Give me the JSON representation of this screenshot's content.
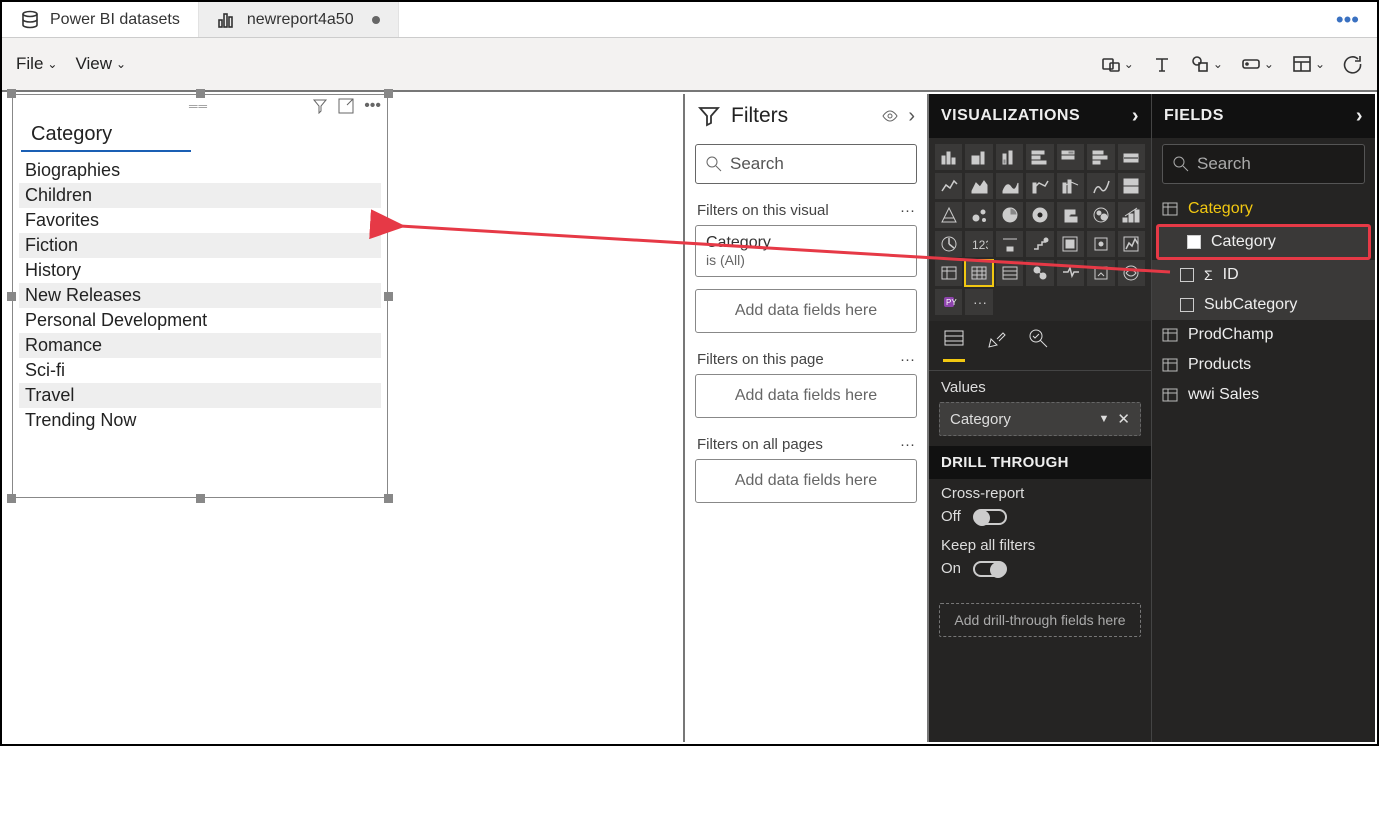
{
  "tabs": {
    "datasets": "Power BI datasets",
    "report": "newreport4a50"
  },
  "ribbon": {
    "file": "File",
    "view": "View"
  },
  "visual": {
    "title": "Category",
    "items": [
      "Biographies",
      "Children",
      "Favorites",
      "Fiction",
      "History",
      "New Releases",
      "Personal Development",
      "Romance",
      "Sci-fi",
      "Travel",
      "Trending Now"
    ]
  },
  "filters": {
    "title": "Filters",
    "search_placeholder": "Search",
    "section_visual": "Filters on this visual",
    "card_field": "Category",
    "card_state": "is (All)",
    "placeholder": "Add data fields here",
    "section_page": "Filters on this page",
    "section_all": "Filters on all pages"
  },
  "viz": {
    "title": "VISUALIZATIONS",
    "values_label": "Values",
    "values_chip": "Category",
    "drill_title": "DRILL THROUGH",
    "cross_report": "Cross-report",
    "off": "Off",
    "keep_filters": "Keep all filters",
    "on": "On",
    "drill_placeholder": "Add drill-through fields here"
  },
  "fields": {
    "title": "FIELDS",
    "search_placeholder": "Search",
    "tables": {
      "category": "Category",
      "category_col": "Category",
      "id": "ID",
      "subcategory": "SubCategory",
      "prodchamp": "ProdChamp",
      "products": "Products",
      "wwi": "wwi Sales"
    }
  }
}
